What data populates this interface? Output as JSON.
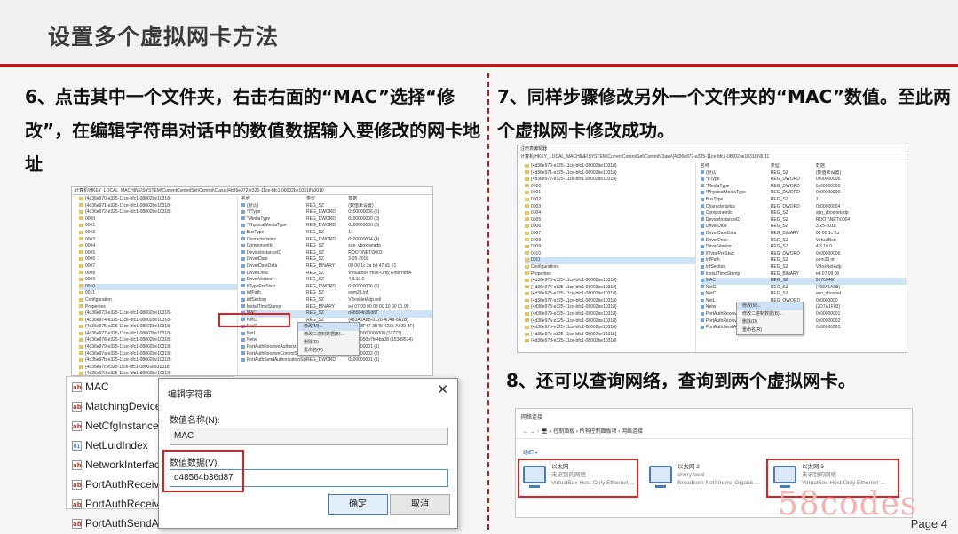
{
  "title": "设置多个虚拟网卡方法",
  "steps": {
    "step6": "6、点击其中一个文件夹，右击右面的“MAC”选择“修改”，在编辑字符串对话中的数值数据输入要修改的网卡地址",
    "step7": "7、同样步骤修改另外一个文件夹的“MAC”数值。至此两个虚拟网卡修改成功。",
    "step8": "8、还可以查询网络，查询到两个虚拟网卡。"
  },
  "reg1": {
    "addr": "计算机\\HKEY_LOCAL_MACHINE\\SYSTEM\\CurrentControlSet\\Control\\Class\\{4d36e972-e325-11ce-bfc1-08002be10318}\\0010",
    "tree": [
      "{4d36e970-e325-11ce-bfc1-08002be10318}",
      "{4d36e971-e325-11ce-bfc1-08002be10318}",
      "{4d36e972-e325-11ce-bfc1-08002be10318}",
      "0000",
      "0001",
      "0002",
      "0003",
      "0004",
      "0005",
      "0006",
      "0007",
      "0008",
      "0009",
      "0010",
      "0011",
      "Configuration",
      "Properties",
      "{4d36e973-e325-11ce-bfc1-08002be10318}",
      "{4d36e974-e325-11ce-bfc1-08002be10318}",
      "{4d36e975-e325-11ce-bfc1-08002be10318}",
      "{4d36e977-e325-11ce-bfc1-08002be10318}",
      "{4d36e978-e325-11ce-bfc1-08002be10318}",
      "{4d36e979-e325-11ce-bfc1-08002be10318}",
      "{4d36e97a-e325-11ce-bfc1-08002be10318}",
      "{4d36e97b-e325-11ce-bfc1-08002be10318}",
      "{4d36e97c-e325-11ce-bfc1-08002be10318}",
      "{4d36e97d-e325-11ce-bfc1-08002be10318}"
    ],
    "vals": [
      [
        "名称",
        "类型",
        "数据"
      ],
      [
        "(默认)",
        "REG_SZ",
        "(数值未设置)"
      ],
      [
        "*IfType",
        "REG_DWORD",
        "0x00000006 (6)"
      ],
      [
        "*MediaType",
        "REG_DWORD",
        "0x00000000 (0)"
      ],
      [
        "*PhysicalMediaType",
        "REG_DWORD",
        "0x00000000 (0)"
      ],
      [
        "BusType",
        "REG_SZ",
        "1"
      ],
      [
        "Characteristics",
        "REG_DWORD",
        "0x00000004 (4)"
      ],
      [
        "ComponentId",
        "REG_SZ",
        "sun_vboxnetadp"
      ],
      [
        "DeviceInstanceID",
        "REG_SZ",
        "ROOT\\NET\\0003"
      ],
      [
        "DriverDate",
        "REG_SZ",
        "3-25-2018"
      ],
      [
        "DriverDateData",
        "REG_BINARY",
        "00 00 1c 2a bd 47 d1 01"
      ],
      [
        "DriverDesc",
        "REG_SZ",
        "VirtualBox Host-Only Ethernet A"
      ],
      [
        "DriverVersion",
        "REG_SZ",
        "4.3.10.0"
      ],
      [
        "IfTypePreStart",
        "REG_DWORD",
        "0x00000006 (6)"
      ],
      [
        "InfPath",
        "REG_SZ",
        "oem23.inf"
      ],
      [
        "InfSection",
        "REG_SZ",
        "VBoxNetAdp.ndi"
      ],
      [
        "InstallTimeStamp",
        "REG_BINARY",
        "e4 07 09 00 03 00 10 00 01 00"
      ],
      [
        "MAC",
        "REG_SZ",
        "d48564b36d87"
      ],
      [
        "NetC",
        "REG_SZ",
        "{483A1A8B-0120-4D48-8A1B}"
      ],
      [
        "NetC",
        "REG_SZ",
        "{0B3E8F47-3B45-4235-A929-8F}"
      ],
      [
        "NetL",
        "REG_QWORD",
        "0x0000000000000 (32773)"
      ],
      [
        "Netw",
        "REG_SZ",
        "0x1d8050b7fe4ba08 (15349574)"
      ],
      [
        "PortAuthReceiveAuthorizationState",
        "REG_DWORD",
        "0x00000001 (1)"
      ],
      [
        "PortAuthReceiveControlState",
        "REG_DWORD",
        "0x00000002 (2)"
      ],
      [
        "PortAuthSendAuthorizationState",
        "REG_DWORD",
        "0x00000001 (1)"
      ]
    ],
    "ctx": [
      "修改(M)...",
      "修改二进制数据(B)...",
      "删除(D)",
      "重命名(R)"
    ]
  },
  "reg2": {
    "title": "注册表编辑器",
    "addr": "计算机\\HKEY_LOCAL_MACHINE\\SYSTEM\\CurrentControlSet\\Control\\Class\\{4d36e972-e325-11ce-bfc1-08002be10318}\\0011",
    "tree": [
      "{4d36e970-e325-11ce-bfc1-08002be10318}",
      "{4d36e971-e325-11ce-bfc1-08002be10318}",
      "{4d36e972-e325-11ce-bfc1-08002be10318}",
      "0000",
      "0001",
      "0002",
      "0003",
      "0004",
      "0005",
      "0006",
      "0007",
      "0008",
      "0009",
      "0010",
      "0011",
      "Configuration",
      "Properties",
      "{4d36e973-e325-11ce-bfc1-08002be10318}",
      "{4d36e974-e325-11ce-bfc1-08002be10318}",
      "{4d36e975-e325-11ce-bfc1-08002be10318}",
      "{4d36e977-e325-11ce-bfc1-08002be10318}",
      "{4d36e978-e325-11ce-bfc1-08002be10318}",
      "{4d36e979-e325-11ce-bfc1-08002be10318}",
      "{4d36e97a-e325-11ce-bfc1-08002be10318}",
      "{4d36e97b-e325-11ce-bfc1-08002be10318}",
      "{4d36e97c-e325-11ce-bfc1-08002be10318}",
      "{4d36e97d-e325-11ce-bfc1-08002be10318}"
    ],
    "vals": [
      [
        "名称",
        "类型",
        "数据"
      ],
      [
        "(默认)",
        "REG_SZ",
        "(数值未设置)"
      ],
      [
        "*IfType",
        "REG_DWORD",
        "0x00000006"
      ],
      [
        "*MediaType",
        "REG_DWORD",
        "0x00000000"
      ],
      [
        "*PhysicalMediaType",
        "REG_DWORD",
        "0x00000000"
      ],
      [
        "BusType",
        "REG_SZ",
        "1"
      ],
      [
        "Characteristics",
        "REG_DWORD",
        "0x00000004"
      ],
      [
        "ComponentId",
        "REG_SZ",
        "sun_vboxnetadp"
      ],
      [
        "DeviceInstanceID",
        "REG_SZ",
        "ROOT\\NET\\0004"
      ],
      [
        "DriverDate",
        "REG_SZ",
        "3-25-2018"
      ],
      [
        "DriverDateData",
        "REG_BINARY",
        "00 00 1c 2a"
      ],
      [
        "DriverDesc",
        "REG_SZ",
        "VirtualBox"
      ],
      [
        "DriverVersion",
        "REG_SZ",
        "4.3.10.0"
      ],
      [
        "IfTypePreStart",
        "REG_DWORD",
        "0x00000006"
      ],
      [
        "InfPath",
        "REG_SZ",
        "oem23.inf"
      ],
      [
        "InfSection",
        "REG_SZ",
        "VBoxNetAdp"
      ],
      [
        "InstallTimeStamp",
        "REG_BINARY",
        "e4 07 09 00"
      ],
      [
        "MAC",
        "REG_SZ",
        "50769460"
      ],
      [
        "NetC",
        "REG_SZ",
        "{483A1A8B}"
      ],
      [
        "NetC",
        "REG_SZ",
        "sun_vboxnet"
      ],
      [
        "NetL",
        "REG_QWORD",
        "0x0000000"
      ],
      [
        "Netw",
        "REG_SZ",
        "{2D7A1F03}"
      ],
      [
        "PortAuthReceiveAuthorizationState",
        "REG_DWORD",
        "0x00000001"
      ],
      [
        "PortAuthReceiveControlState",
        "REG_DWORD",
        "0x00000002"
      ],
      [
        "PortAuthSendAuthorizationState",
        "REG_DWORD",
        "0x00000001"
      ]
    ],
    "ctx": [
      "修改(M)...",
      "修改二进制数据(B)...",
      "删除(D)",
      "重命名(R)"
    ]
  },
  "list_under": [
    "MAC",
    "MatchingDeviceId",
    "NetCfgInstanceId",
    "NetLuidIndex",
    "NetworkInterfaceInstanceId",
    "PortAuthReceiveAuthorizationState",
    "PortAuthReceiveControlState",
    "PortAuthSendAuthorizationState"
  ],
  "dialog": {
    "title": "编辑字符串",
    "close": "✕",
    "name_label": "数值名称(N):",
    "name_value": "MAC",
    "data_label": "数值数据(V):",
    "data_value": "d48564b36d87",
    "ok": "确定",
    "cancel": "取消"
  },
  "net": {
    "title": "网络连接",
    "breadcrumb": "← → ↑ 🖥 » 控制面板 › 所有控制面板项 › 网络连接",
    "organize": "组织 ▾",
    "adapters": [
      {
        "name": "以太网",
        "status": "未识别的网络",
        "desc": "VirtualBox Host-Only Ethernet ..."
      },
      {
        "name": "以太网 2",
        "status": "chery.local",
        "desc": "Broadcom NetXtreme Gigabit ..."
      },
      {
        "name": "以太网 3",
        "status": "未识别的网络",
        "desc": "VirtualBox Host-Only Ethernet ..."
      }
    ]
  },
  "watermark": "58codes",
  "page": "Page 4"
}
